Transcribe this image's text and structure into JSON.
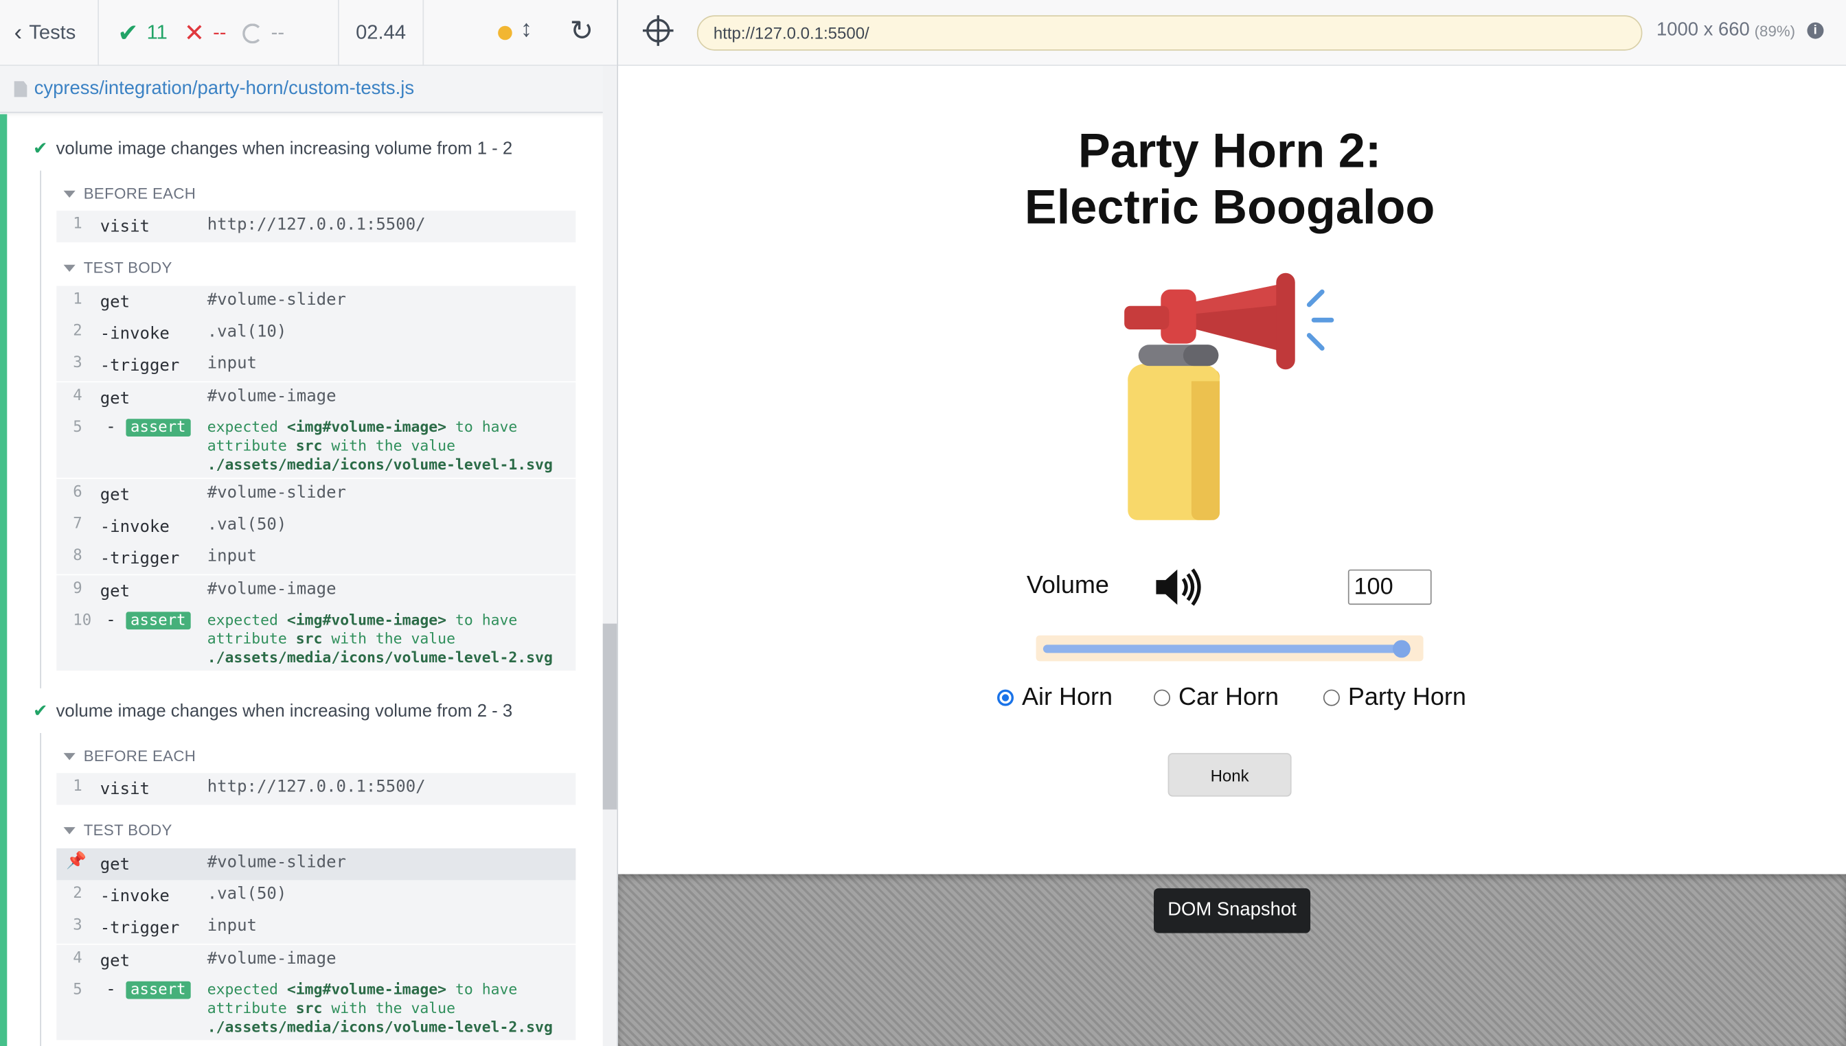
{
  "reporter": {
    "tests_label": "Tests",
    "passed_count": "11",
    "failed_count": "--",
    "pending_count": "--",
    "duration": "02.44",
    "spec_path": "cypress/integration/party-horn/custom-tests.js"
  },
  "tests": [
    {
      "title": "volume image changes when increasing volume from 1 - 2",
      "before_each_label": "BEFORE EACH",
      "test_body_label": "TEST BODY",
      "before_each": [
        {
          "num": "1",
          "name": "visit",
          "message": "http://127.0.0.1:5500/"
        }
      ],
      "body": [
        {
          "num": "1",
          "name": "get",
          "message": "#volume-slider"
        },
        {
          "num": "2",
          "name": "-invoke",
          "message": ".val(10)"
        },
        {
          "num": "3",
          "name": "-trigger",
          "message": "input"
        },
        {
          "num": "4",
          "name": "get",
          "message": "#volume-image"
        },
        {
          "num": "5",
          "name": "assert",
          "expected": "expected",
          "subject": "<img#volume-image>",
          "to_have": "to have",
          "attribute": "attribute",
          "attr_name": "src",
          "with_value": "with the value",
          "value": "./assets/media/icons/volume-level-1.svg"
        },
        {
          "num": "6",
          "name": "get",
          "message": "#volume-slider"
        },
        {
          "num": "7",
          "name": "-invoke",
          "message": ".val(50)"
        },
        {
          "num": "8",
          "name": "-trigger",
          "message": "input"
        },
        {
          "num": "9",
          "name": "get",
          "message": "#volume-image"
        },
        {
          "num": "10",
          "name": "assert",
          "expected": "expected",
          "subject": "<img#volume-image>",
          "to_have": "to have",
          "attribute": "attribute",
          "attr_name": "src",
          "with_value": "with the value",
          "value": "./assets/media/icons/volume-level-2.svg"
        }
      ]
    },
    {
      "title": "volume image changes when increasing volume from 2 - 3",
      "before_each_label": "BEFORE EACH",
      "test_body_label": "TEST BODY",
      "before_each": [
        {
          "num": "1",
          "name": "visit",
          "message": "http://127.0.0.1:5500/"
        }
      ],
      "body": [
        {
          "num": "1",
          "name": "get",
          "message": "#volume-slider"
        },
        {
          "num": "2",
          "name": "-invoke",
          "message": ".val(50)"
        },
        {
          "num": "3",
          "name": "-trigger",
          "message": "input"
        },
        {
          "num": "4",
          "name": "get",
          "message": "#volume-image"
        },
        {
          "num": "5",
          "name": "assert",
          "expected": "expected",
          "subject": "<img#volume-image>",
          "to_have": "to have",
          "attribute": "attribute",
          "attr_name": "src",
          "with_value": "with the value",
          "value": "./assets/media/icons/volume-level-2.svg"
        }
      ]
    }
  ],
  "browser": {
    "url": "http://127.0.0.1:5500/",
    "viewport": "1000 x 660",
    "scale": "(89%)"
  },
  "app": {
    "title_line1": "Party Horn 2:",
    "title_line2": "Electric Boogaloo",
    "volume_label": "Volume",
    "volume_value": "100",
    "volume_level_fraction": 1.0,
    "horns": [
      {
        "label": "Air Horn",
        "checked": true
      },
      {
        "label": "Car Horn",
        "checked": false
      },
      {
        "label": "Party Horn",
        "checked": false
      }
    ],
    "honk_label": "Honk"
  },
  "snapshot_label": "DOM Snapshot",
  "colors": {
    "pass": "#21a366",
    "fail": "#e0383e",
    "link": "#3b82c4",
    "assert": "#45b07a",
    "radio": "#1a73e8"
  }
}
